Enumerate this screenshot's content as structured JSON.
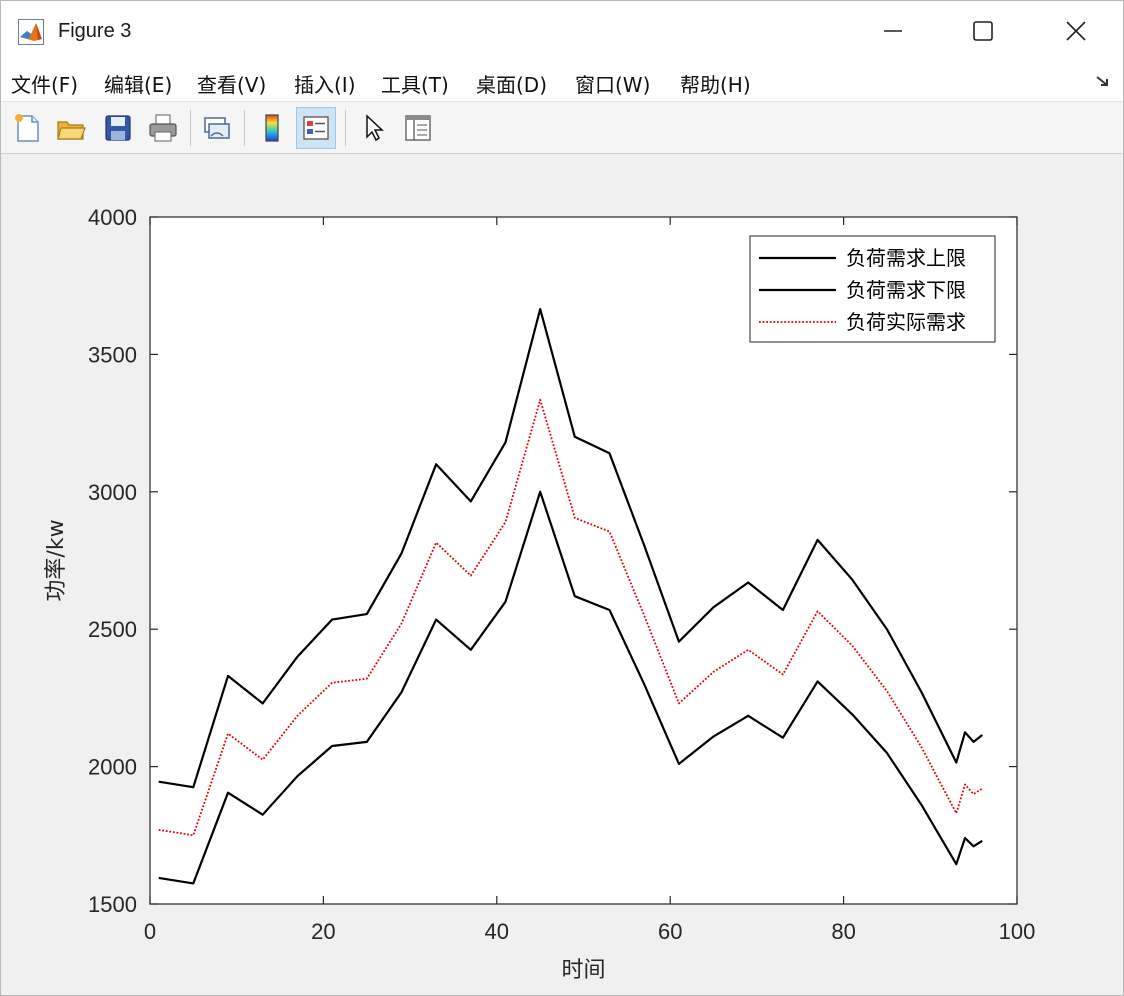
{
  "window": {
    "title": "Figure 3",
    "controls": {
      "minimize": "minimize-icon",
      "maximize": "maximize-icon",
      "close": "close-icon"
    }
  },
  "menu": [
    {
      "label": "文件(F)"
    },
    {
      "label": "编辑(E)"
    },
    {
      "label": "查看(V)"
    },
    {
      "label": "插入(I)"
    },
    {
      "label": "工具(T)"
    },
    {
      "label": "桌面(D)"
    },
    {
      "label": "窗口(W)"
    },
    {
      "label": "帮助(H)"
    }
  ],
  "toolbar": [
    {
      "icon": "new-figure-icon"
    },
    {
      "icon": "open-file-icon"
    },
    {
      "icon": "save-icon"
    },
    {
      "icon": "print-icon"
    },
    {
      "icon": "link-plot-icon"
    },
    {
      "icon": "colorbar-icon"
    },
    {
      "icon": "legend-icon",
      "active": true
    },
    {
      "icon": "pointer-icon"
    },
    {
      "icon": "property-inspector-icon"
    }
  ],
  "chart_data": {
    "type": "line",
    "title": "",
    "xlabel": "时间",
    "ylabel": "功率/kw",
    "xlim": [
      0,
      100
    ],
    "ylim": [
      1500,
      4000
    ],
    "xticks": [
      0,
      20,
      40,
      60,
      80,
      100
    ],
    "yticks": [
      1500,
      2000,
      2500,
      3000,
      3500,
      4000
    ],
    "grid": false,
    "legend_position": "top-right",
    "x": [
      1,
      5,
      9,
      13,
      17,
      21,
      25,
      29,
      33,
      37,
      41,
      45,
      49,
      53,
      57,
      61,
      65,
      69,
      73,
      77,
      81,
      85,
      89,
      93,
      94,
      95,
      96
    ],
    "series": [
      {
        "name": "负荷需求上限",
        "color": "#000000",
        "style": "solid",
        "values": [
          1945,
          1925,
          2330,
          2230,
          2400,
          2535,
          2555,
          2775,
          3100,
          2965,
          3180,
          3665,
          3200,
          3140,
          2805,
          2455,
          2580,
          2670,
          2570,
          2825,
          2680,
          2500,
          2270,
          2015,
          2125,
          2090,
          2115
        ]
      },
      {
        "name": "负荷需求下限",
        "color": "#000000",
        "style": "solid",
        "values": [
          1595,
          1575,
          1905,
          1825,
          1965,
          2075,
          2090,
          2270,
          2535,
          2425,
          2600,
          3000,
          2620,
          2570,
          2300,
          2010,
          2110,
          2185,
          2105,
          2310,
          2190,
          2050,
          1860,
          1645,
          1740,
          1710,
          1730
        ]
      },
      {
        "name": "负荷实际需求",
        "color": "#e00000",
        "style": "dotted",
        "values": [
          1770,
          1750,
          2120,
          2025,
          2185,
          2305,
          2320,
          2520,
          2815,
          2695,
          2890,
          3335,
          2905,
          2855,
          2550,
          2230,
          2345,
          2425,
          2335,
          2565,
          2440,
          2275,
          2070,
          1830,
          1935,
          1900,
          1920
        ]
      }
    ]
  }
}
